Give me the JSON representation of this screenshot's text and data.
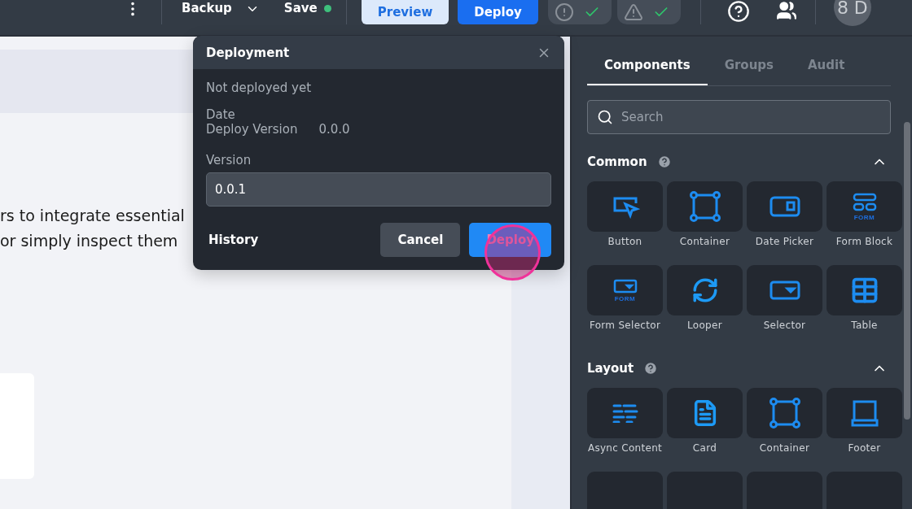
{
  "toolbar": {
    "backup": "Backup",
    "save": "Save",
    "saved": true,
    "preview": "Preview",
    "deploy": "Deploy",
    "avatar": "8 D"
  },
  "canvas": {
    "lines": [
      "rs to integrate essential",
      "or simply inspect them"
    ]
  },
  "dialog": {
    "title": "Deployment",
    "status": "Not deployed yet",
    "date_label": "Date",
    "deploy_version_label": "Deploy Version",
    "deploy_version": "0.0.0",
    "version_label": "Version",
    "version_value": "0.0.1",
    "history": "History",
    "cancel": "Cancel",
    "deploy": "Deploy"
  },
  "panel": {
    "tabs": [
      {
        "label": "Components",
        "selected": true
      },
      {
        "label": "Groups",
        "selected": false
      },
      {
        "label": "Audit",
        "selected": false
      }
    ],
    "search": {
      "placeholder": "Search"
    },
    "sections": [
      {
        "title": "Common",
        "expanded": true,
        "items": [
          {
            "label": "Button"
          },
          {
            "label": "Container"
          },
          {
            "label": "Date Picker"
          },
          {
            "label": "Form Block",
            "badge": "FORM"
          },
          {
            "label": "Form Selector",
            "badge": "FORM"
          },
          {
            "label": "Looper"
          },
          {
            "label": "Selector"
          },
          {
            "label": "Table"
          }
        ]
      },
      {
        "title": "Layout",
        "expanded": true,
        "items": [
          {
            "label": "Async Content"
          },
          {
            "label": "Card"
          },
          {
            "label": "Container"
          },
          {
            "label": "Footer"
          }
        ]
      }
    ]
  }
}
